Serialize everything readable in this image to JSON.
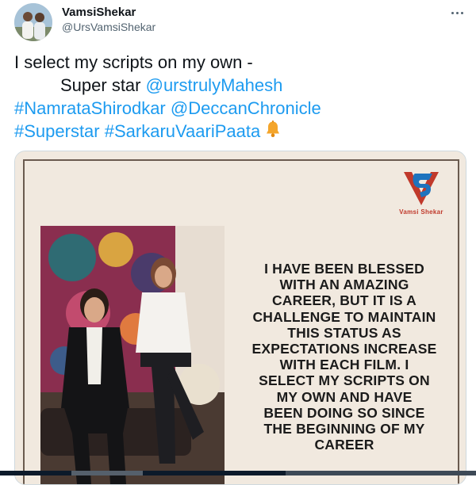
{
  "author": {
    "display_name": "VamsiShekar",
    "handle": "@UrsVamsiShekar"
  },
  "header": {
    "more_icon": "more-horizontal-icon"
  },
  "tweet": {
    "line1": "I select my scripts on my own -",
    "line2_text": "Super star ",
    "mention_mahesh": "@urstrulyMahesh",
    "hashtag_namrata": "#NamrataShirodkar",
    "mention_deccan": "@DeccanChronicle",
    "hashtag_superstar": "#Superstar",
    "hashtag_svp": "#SarkaruVaariPaata",
    "bell_icon": "bell-emoji-icon"
  },
  "poster": {
    "logo_caption": "Vamsi Shekar",
    "quote_lines": [
      "I HAVE BEEN BLESSED",
      "WITH AN AMAZING",
      "CAREER, BUT IT IS A",
      "CHALLENGE TO MAINTAIN",
      "THIS STATUS AS",
      "EXPECTATIONS INCREASE",
      "WITH EACH FILM. I",
      "SELECT MY SCRIPTS ON",
      "MY OWN AND HAVE",
      "BEEN DOING SO SINCE",
      "THE BEGINNING OF MY",
      "CAREER"
    ]
  },
  "colors": {
    "link": "#1d9bf0",
    "text": "#0f1419",
    "secondary": "#536471",
    "poster_bg": "#f1e9df",
    "logo_red": "#c0392b",
    "logo_blue": "#1e73be"
  }
}
